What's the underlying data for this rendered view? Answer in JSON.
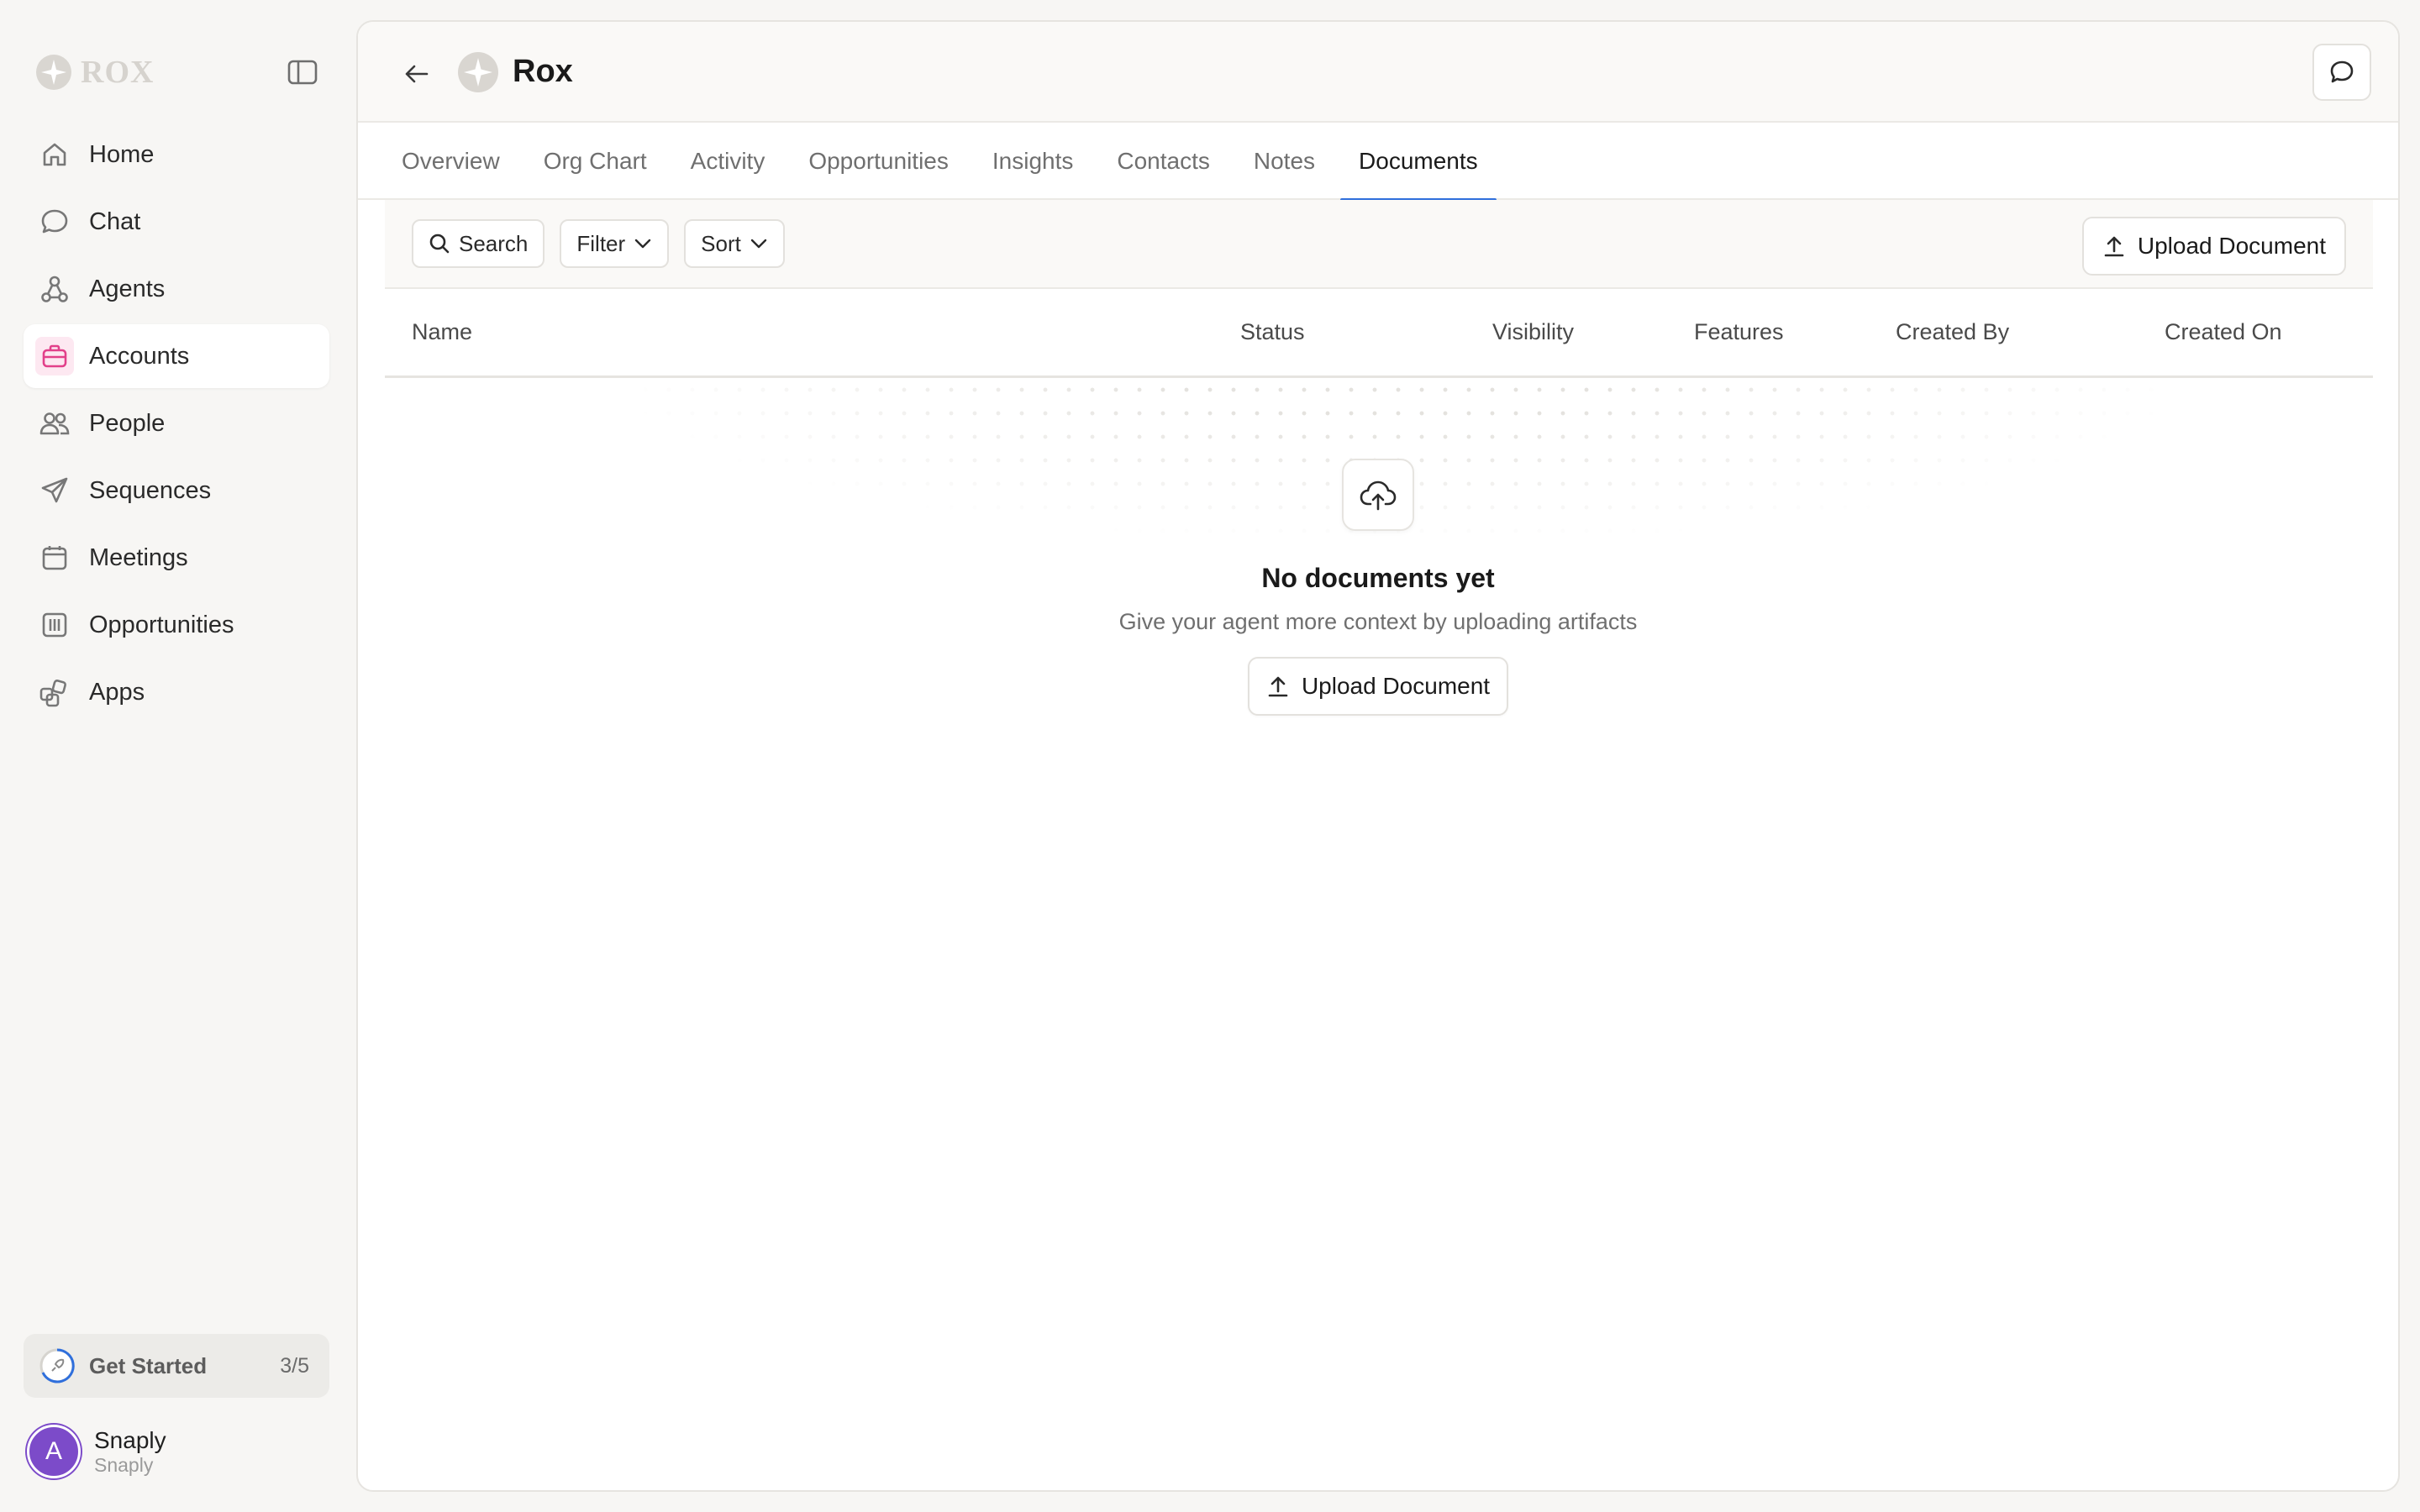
{
  "sidebar": {
    "brand": "ROX",
    "nav": [
      {
        "label": "Home",
        "icon": "home-icon"
      },
      {
        "label": "Chat",
        "icon": "chat-bubble-icon"
      },
      {
        "label": "Agents",
        "icon": "agents-icon"
      },
      {
        "label": "Accounts",
        "icon": "briefcase-icon",
        "active": true
      },
      {
        "label": "People",
        "icon": "people-icon"
      },
      {
        "label": "Sequences",
        "icon": "paper-plane-icon"
      },
      {
        "label": "Meetings",
        "icon": "calendar-icon"
      },
      {
        "label": "Opportunities",
        "icon": "columns-icon"
      },
      {
        "label": "Apps",
        "icon": "apps-icon"
      }
    ],
    "get_started": {
      "label": "Get Started",
      "progress": "3/5"
    },
    "user": {
      "initial": "A",
      "name": "Snaply",
      "org": "Snaply"
    }
  },
  "header": {
    "account_name": "Rox"
  },
  "tabs": [
    {
      "label": "Overview"
    },
    {
      "label": "Org Chart"
    },
    {
      "label": "Activity"
    },
    {
      "label": "Opportunities"
    },
    {
      "label": "Insights"
    },
    {
      "label": "Contacts"
    },
    {
      "label": "Notes"
    },
    {
      "label": "Documents",
      "active": true
    }
  ],
  "toolbar": {
    "search_label": "Search",
    "filter_label": "Filter",
    "sort_label": "Sort",
    "upload_label": "Upload Document"
  },
  "table": {
    "columns": [
      "Name",
      "Status",
      "Visibility",
      "Features",
      "Created By",
      "Created On"
    ]
  },
  "empty_state": {
    "title": "No documents yet",
    "subtitle": "Give your agent more context by uploading artifacts",
    "button_label": "Upload Document"
  },
  "colors": {
    "accent": "#2f6fdc",
    "active_icon": "#e2408a",
    "avatar": "#7c4bc9"
  }
}
